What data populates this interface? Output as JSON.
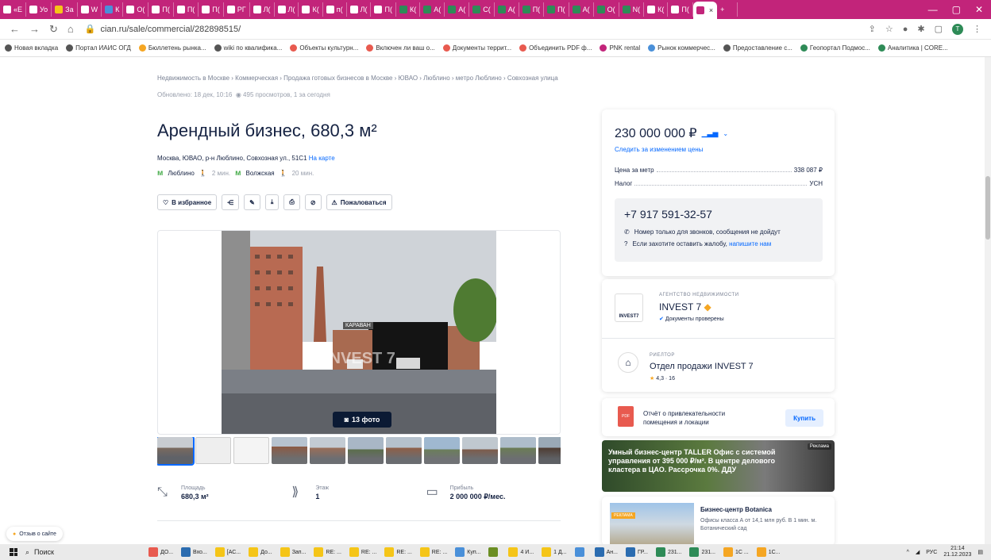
{
  "browser": {
    "tabs": [
      {
        "label": "«Е",
        "color": "#ffffff"
      },
      {
        "label": "Уо",
        "color": "#ffffff"
      },
      {
        "label": "За",
        "color": "#f5c518"
      },
      {
        "label": "W",
        "color": "#ffffff"
      },
      {
        "label": "К",
        "color": "#4a90d9"
      },
      {
        "label": "О(",
        "color": "#ffffff"
      },
      {
        "label": "П(",
        "color": "#ffffff"
      },
      {
        "label": "П(",
        "color": "#ffffff"
      },
      {
        "label": "П(",
        "color": "#ffffff"
      },
      {
        "label": "РГ",
        "color": "#ffffff"
      },
      {
        "label": "Л(",
        "color": "#ffffff"
      },
      {
        "label": "Л(",
        "color": "#ffffff"
      },
      {
        "label": "К(",
        "color": "#ffffff"
      },
      {
        "label": "п(",
        "color": "#ffffff"
      },
      {
        "label": "Л(",
        "color": "#ffffff"
      },
      {
        "label": "П(",
        "color": "#ffffff"
      },
      {
        "label": "К(",
        "color": "#2e8b57"
      },
      {
        "label": "А(",
        "color": "#2e8b57"
      },
      {
        "label": "А(",
        "color": "#2e8b57"
      },
      {
        "label": "С(",
        "color": "#2e8b57"
      },
      {
        "label": "А(",
        "color": "#2e8b57"
      },
      {
        "label": "П(",
        "color": "#2e8b57"
      },
      {
        "label": "П(",
        "color": "#2e8b57"
      },
      {
        "label": "А(",
        "color": "#2e8b57"
      },
      {
        "label": "О(",
        "color": "#2e8b57"
      },
      {
        "label": "N(",
        "color": "#2e8b57"
      },
      {
        "label": "К(",
        "color": "#ffffff"
      },
      {
        "label": "П(",
        "color": "#ffffff"
      }
    ],
    "active_tab": "",
    "url": "cian.ru/sale/commercial/282898515/",
    "bookmarks": [
      "Новая вкладка",
      "Портал ИАИС ОГД",
      "Бюллетень рынка...",
      "wiki по квалифика...",
      "Объекты культурн...",
      "Включен ли ваш о...",
      "Документы террит...",
      "Объединить PDF ф...",
      "PNK rental",
      "Рынок коммерчес...",
      "Предоставление с...",
      "Геопортал Подмос...",
      "Аналитика | CORE..."
    ],
    "avatar": "T"
  },
  "page": {
    "breadcrumb": "Недвижимость в Москве › Коммерческая › Продажа готовых бизнесов в Москве › ЮВАО › Люблино › метро Люблино › Совхозная улица",
    "updated": "Обновлено: 18 дек, 10:16",
    "views": "495 просмотров, 1 за сегодня",
    "title": "Арендный бизнес, 680,3 м²",
    "address": "Москва, ЮВАО, р-н Люблино, Совхозная ул., 51С1",
    "map_link": "На карте",
    "metro": [
      {
        "name": "Люблино",
        "time": "2 мин."
      },
      {
        "name": "Волжская",
        "time": "20 мин."
      }
    ],
    "fav_label": "В избранное",
    "complain_label": "Пожаловаться",
    "photo_count": "13 фото",
    "watermark": "INVEST 7",
    "sign": "КАРАВАН"
  },
  "facts": [
    {
      "label": "Площадь",
      "value": "680,3 м²",
      "icon": "area-icon"
    },
    {
      "label": "Этаж",
      "value": "1",
      "icon": "floor-icon"
    },
    {
      "label": "Прибыль",
      "value": "2 000 000 ₽/мес.",
      "icon": "profit-icon"
    }
  ],
  "price": {
    "value": "230 000 000 ₽",
    "follow": "Следить за изменением цены",
    "per_meter_label": "Цена за метр",
    "per_meter": "338 087 ₽",
    "tax_label": "Налог",
    "tax": "УСН",
    "phone": "+7 917 591-32-57",
    "note1": "Номер только для звонков, сообщения не дойдут",
    "note2": "Если захотите оставить жалобу,",
    "note2_link": "напишите нам"
  },
  "agency": {
    "kind": "АГЕНТСТВО НЕДВИЖИМОСТИ",
    "name": "INVEST 7",
    "logo": "INVEST7",
    "docs": "Документы проверены",
    "realtor_kind": "РИЕЛТОР",
    "realtor_name": "Отдел продажи INVEST 7",
    "rating": "4,3 · 16"
  },
  "report": {
    "text": "Отчёт о привлекательности помещения и локации",
    "button": "Купить",
    "pdf": "PDF"
  },
  "ads": {
    "ad1_text": "Умный бизнес-центр TALLER Офис с системой управления от 395 000 ₽/м². В центре делового кластера в ЦАО. Рассрочка 0%. ДДУ",
    "ad1_tag": "Реклама",
    "ad2_tag": "РЕКЛАМА",
    "ad2_title": "Бизнес-центр Botanica",
    "ad2_desc": "Офисы класса А от 14,1 млн руб. В 1 мин. м. Ботанический сад"
  },
  "feedback": "Отзыв о сайте",
  "taskbar": {
    "search": "Поиск",
    "items": [
      "ДО...",
      "Вхо...",
      "[АС...",
      "До...",
      "Зап...",
      "RE: ...",
      "RE: ...",
      "RE: ...",
      "RE: ...",
      "Куп...",
      "",
      "4 И...",
      "1 Д...",
      "",
      "Ан...",
      "ГР...",
      "231...",
      "231...",
      "1С ...",
      "1С..."
    ],
    "lang": "РУС",
    "time": "21:14",
    "date": "21.12.2023"
  }
}
